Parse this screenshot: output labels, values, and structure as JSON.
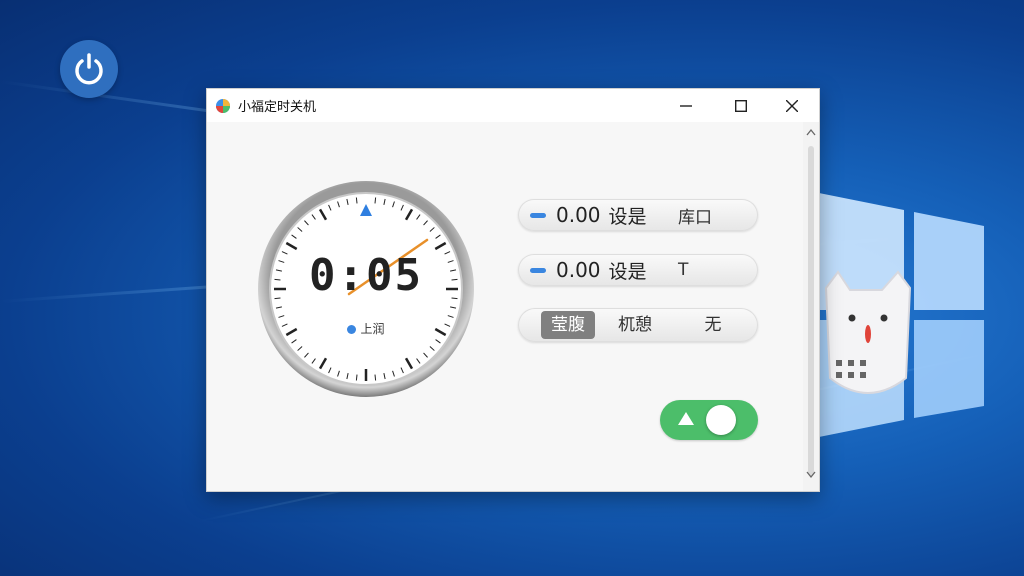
{
  "window": {
    "title": "小福定时关机"
  },
  "clock": {
    "digital_time": "0:05",
    "mode_label": "上润"
  },
  "settings": {
    "row1": {
      "value": "0.00",
      "label": "设是",
      "right": "库口"
    },
    "row2": {
      "value": "0.00",
      "label": "设是",
      "right": "T"
    },
    "segments": [
      "莹腹",
      "杌憩",
      "无"
    ],
    "active_segment": "莹腹"
  },
  "toggle": {
    "state": "on",
    "color": "#4cbe6a"
  },
  "colors": {
    "accent": "#3a86e0",
    "clock_hand": "#e8902a",
    "toggle_on": "#4cbe6a"
  }
}
